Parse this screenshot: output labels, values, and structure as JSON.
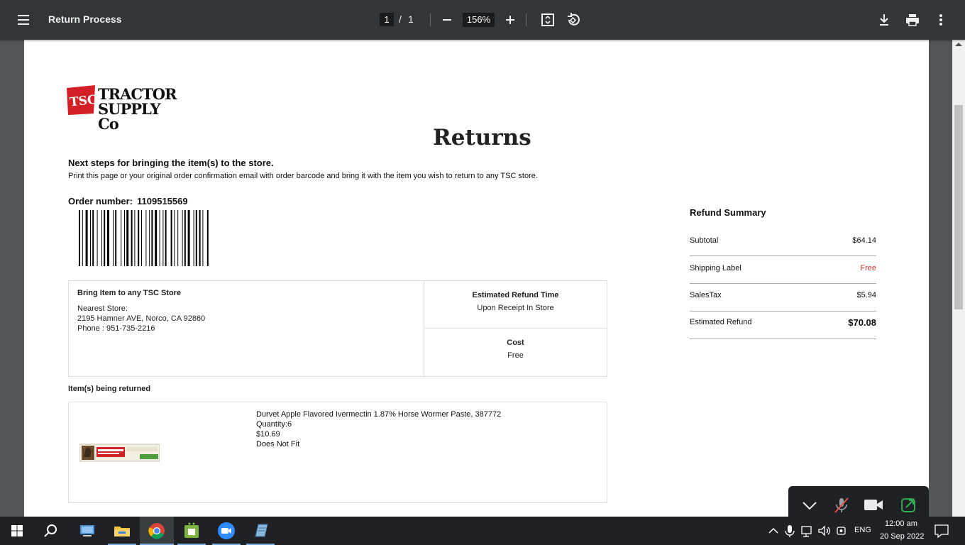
{
  "toolbar": {
    "title": "Return Process",
    "current_page": "1",
    "page_separator": "/",
    "total_pages": "1",
    "zoom": "156%"
  },
  "document": {
    "logo_text_line1": "TRACTOR",
    "logo_text_line2": "SUPPLY Co",
    "logo_badge": "TSC",
    "heading": "Returns",
    "next_steps": "Next steps for bringing the item(s) to the store.",
    "instructions": "Print this page or your original order confirmation email with order barcode and bring it with the item you wish to return to any TSC store.",
    "order_label": "Order number:",
    "order_number": "1109515569",
    "store": {
      "title": "Bring Item to any TSC Store",
      "nearest_label": "Nearest Store:",
      "address": "2195 Hamner AVE,  Norco,  CA  92860",
      "phone": "Phone : 951-735-2216"
    },
    "refund_time": {
      "label": "Estimated Refund Time",
      "value": "Upon Receipt In Store"
    },
    "cost": {
      "label": "Cost",
      "value": "Free"
    },
    "items_label": "Item(s) being returned",
    "item": {
      "name": "Durvet Apple Flavored Ivermectin 1.87% Horse Wormer Paste, 387772",
      "quantity": "Quantity:6",
      "price": "$10.69",
      "reason": "Does Not Fit"
    },
    "summary": {
      "title": "Refund Summary",
      "rows": [
        {
          "label": "Subtotal",
          "value": "$64.14"
        },
        {
          "label": "Shipping Label",
          "value": "Free"
        },
        {
          "label": "SalesTax",
          "value": "$5.94"
        },
        {
          "label": "Estimated Refund",
          "value": "$70.08"
        }
      ]
    }
  },
  "taskbar": {
    "time": "12:00 am",
    "date": "20 Sep 2022",
    "language": "ENG"
  },
  "colors": {
    "toolbar_bg": "#323639",
    "viewer_bg": "#525659",
    "free_red": "#d32f2f",
    "taskbar_bg": "#202124"
  }
}
